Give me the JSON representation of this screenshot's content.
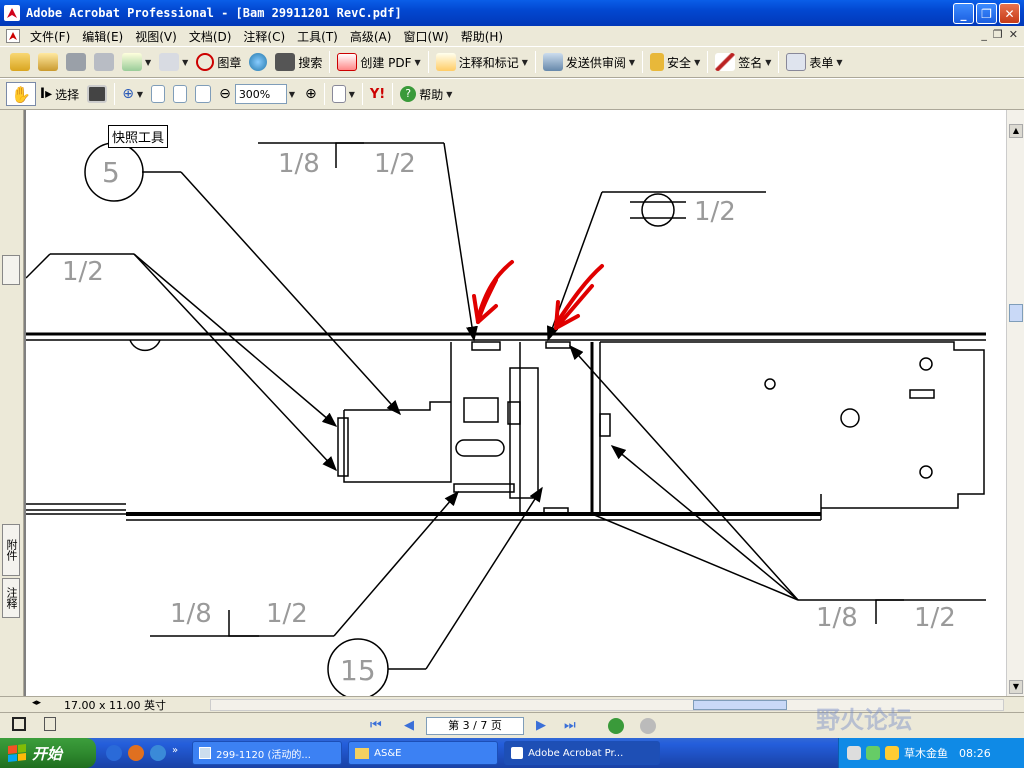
{
  "window": {
    "title": "Adobe Acrobat Professional - [Bam 29911201 RevC.pdf]"
  },
  "menu": [
    "文件(F)",
    "编辑(E)",
    "视图(V)",
    "文档(D)",
    "注释(C)",
    "工具(T)",
    "高级(A)",
    "窗口(W)",
    "帮助(H)"
  ],
  "toolbar1": {
    "stamp_label": "图章",
    "search_label": "搜索",
    "create_pdf_label": "创建 PDF",
    "comment_label": "注释和标记",
    "review_label": "发送供审阅",
    "security_label": "安全",
    "sign_label": "签名",
    "forms_label": "表单"
  },
  "toolbar2": {
    "select_label": "选择",
    "zoom_value": "300%",
    "help_label": "帮助"
  },
  "tooltip": "快照工具",
  "sidetabs": {
    "attachments": "附件",
    "comments": "注释"
  },
  "drawing": {
    "callouts": {
      "weld_top_left": [
        "1/8",
        "1/2"
      ],
      "weld_top_mid": "1/2",
      "weld_left": "1/2",
      "weld_bottom_left": [
        "1/8",
        "1/2"
      ],
      "weld_bottom_right": [
        "1/8",
        "1/2"
      ]
    },
    "balloons": {
      "item_a": "5",
      "item_b": "15"
    }
  },
  "status": {
    "page_size": "17.00 x 11.00 英寸",
    "page_indicator": "第 3 / 7 页"
  },
  "taskbar": {
    "start_label": "开始",
    "items": [
      "299-1120 (活动的...",
      "AS&E",
      "Adobe Acrobat Pr..."
    ],
    "clock": "08:26",
    "tray_text": "草木金鱼"
  },
  "watermark": "野火论坛"
}
